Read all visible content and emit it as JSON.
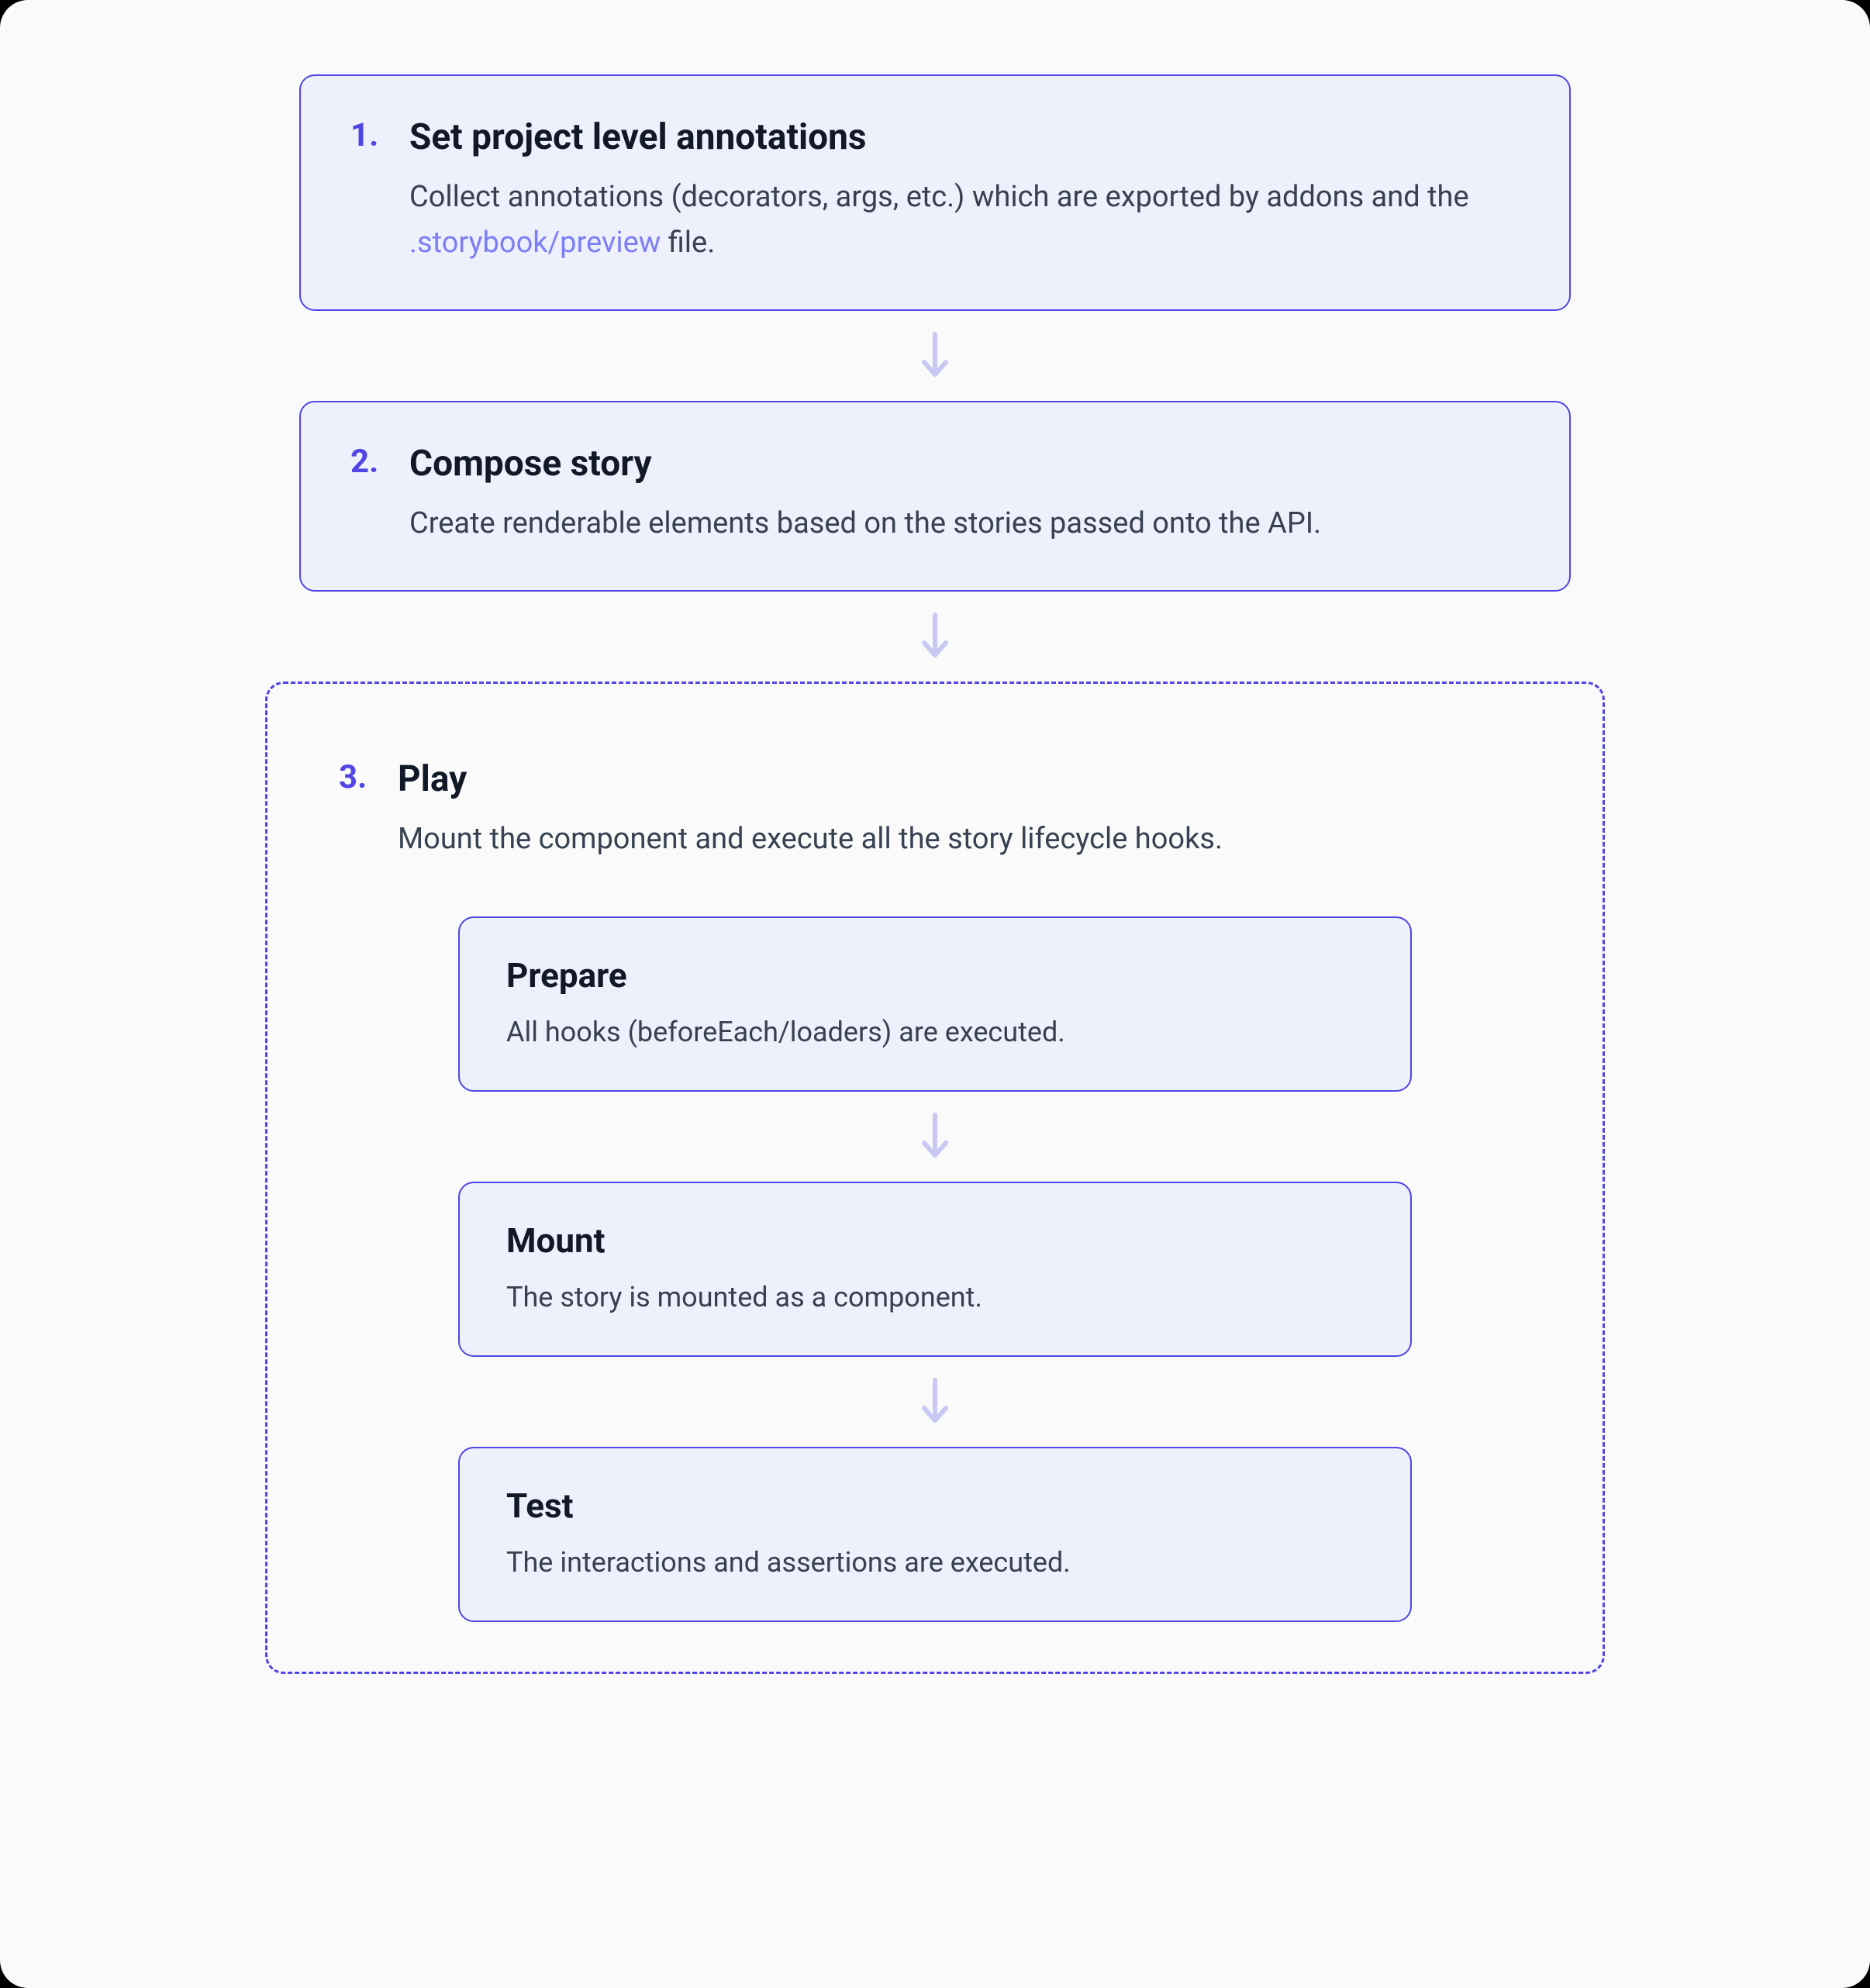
{
  "steps": [
    {
      "num": "1.",
      "title": "Set project level annotations",
      "desc_pre": " Collect annotations (decorators, args, etc.) which are exported by addons and the ",
      "desc_code": ".storybook/preview",
      "desc_post": " file."
    },
    {
      "num": "2.",
      "title": "Compose story",
      "desc": "Create renderable elements based on the stories passed onto the API."
    }
  ],
  "play": {
    "num": "3.",
    "title": "Play",
    "desc": "Mount the component and execute all the story lifecycle hooks.",
    "substeps": [
      {
        "title": "Prepare",
        "desc": "All hooks (beforeEach/loaders) are executed."
      },
      {
        "title": "Mount",
        "desc": "The story is mounted as a component."
      },
      {
        "title": "Test",
        "desc": "The interactions and assertions are executed."
      }
    ]
  },
  "colors": {
    "accent": "#4f46e5",
    "card_bg": "#eef0fb",
    "arrow": "#c7c9f3"
  }
}
